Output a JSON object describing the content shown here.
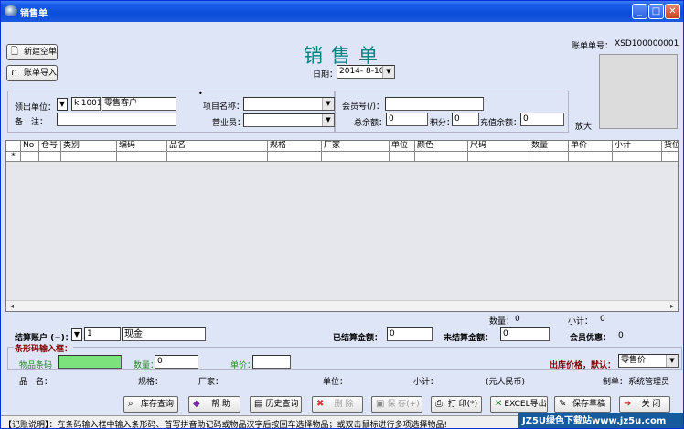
{
  "window": {
    "title": "销售单"
  },
  "header": {
    "title": "销售单",
    "new_button": "新建空单",
    "import_button": "账单导入",
    "date_label": "日期：",
    "date_value": "2014- 8-10",
    "bill_no_label": "账单单号：",
    "bill_no_value": "XSD100000001",
    "zoom_label": "放大"
  },
  "form": {
    "unit_label": "领出单位：",
    "unit_code": "kl1001",
    "unit_name": "零售客户",
    "note_label": "备　注：",
    "note_value": "",
    "project_label": "项目名称：",
    "project_value": "",
    "clerk_label": "营业员：",
    "clerk_value": "",
    "member_label": "会员号(/)：",
    "member_value": "",
    "balance_label": "总余额：",
    "balance_value": "0",
    "points_label": "积分：",
    "points_value": "0",
    "recharge_label": "充值余额：",
    "recharge_value": "0"
  },
  "grid": {
    "columns": [
      "No",
      "仓号",
      "类别",
      "编码",
      "品名",
      "规格",
      "厂家",
      "单位",
      "颜色",
      "尺码",
      "数量",
      "单价",
      "小计",
      "货位"
    ],
    "new_row_marker": "*"
  },
  "summary": {
    "qty_label": "数量：",
    "qty_value": "0",
    "subtotal_label": "小计：",
    "subtotal_value": "0",
    "account_label": "结算账户 (−)：",
    "account_code": "1",
    "account_name": "现金",
    "settled_label": "已结算金额：",
    "settled_value": "0",
    "unsettled_label": "未结算金额：",
    "unsettled_value": "0",
    "member_discount_label": "会员优惠：",
    "member_discount_value": "0"
  },
  "barcode": {
    "group_label": "条形码输入框：",
    "barcode_label": "物品条码",
    "barcode_value": "",
    "qty_label": "数量：",
    "qty_value": "0",
    "price_label": "单价：",
    "price_value": "",
    "price_type_label": "出库价格，默认：",
    "price_type_value": "零售价"
  },
  "info": {
    "name_label": "品　名：",
    "spec_label": "规格：",
    "maker_label": "厂家：",
    "unit_label": "单位：",
    "subtotal_label": "小计：",
    "currency_label": "(元人民币)",
    "creator_label": "制单：",
    "creator_value": "系统管理员"
  },
  "buttons": {
    "stock_query": "库存查询",
    "help": "帮 助",
    "history_query": "历史查询",
    "delete": "删 除",
    "save": "保 存(+)",
    "print": "打 印(*)",
    "excel_export": "EXCEL导出",
    "save_draft": "保存草稿",
    "close": "关 闭"
  },
  "status": {
    "message": "【记账说明】：在条码输入框中输入条形码、首写拼音助记码或物品汉字后按回车选择物品；或双击鼠标进行多项选择物品!",
    "watermark": "JZ5U绿色下载站www.jz5u.com"
  },
  "colors": {
    "titlebar": "#0b4dd8",
    "background": "#dee5f7",
    "title_text": "#008080",
    "barcode_field": "#7ce37c"
  }
}
